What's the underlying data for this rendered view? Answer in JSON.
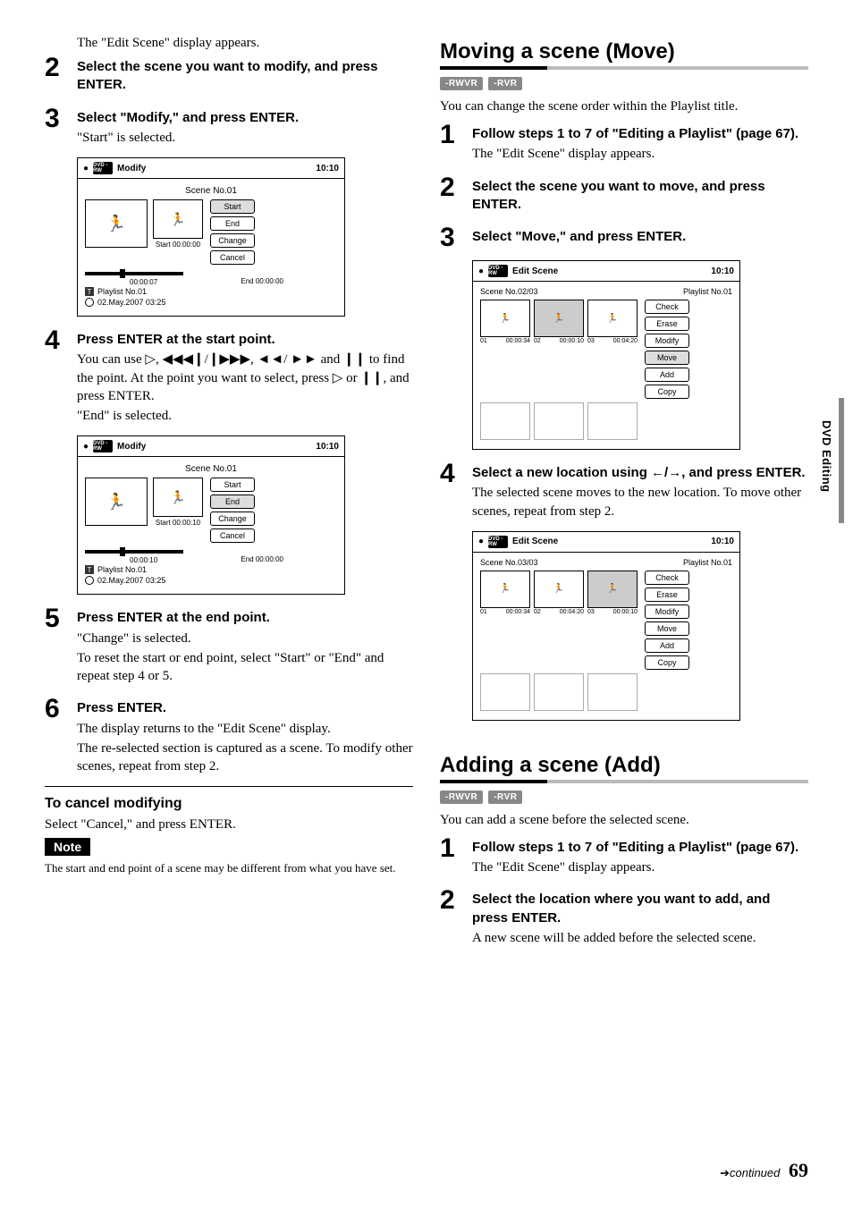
{
  "left": {
    "intro": "The \"Edit Scene\" display appears.",
    "step2": "Select the scene you want to modify, and press ENTER.",
    "step3_bold": "Select \"Modify,\" and press ENTER.",
    "step3_body": "\"Start\" is selected.",
    "ss1": {
      "title": "Modify",
      "clock": "10:10",
      "scene": "Scene No.01",
      "start": "Start  00:00:00",
      "end": "End   00:00:00",
      "barTime": "00:00:07",
      "pl": "Playlist No.01",
      "date": "02.May.2007   03:25",
      "btns": [
        "Start",
        "End",
        "Change",
        "Cancel"
      ],
      "sel": 0
    },
    "step4_bold": "Press ENTER at the start point.",
    "step4_l1a": "You can use ",
    "step4_l1b": ", ",
    "step4_l1c": "/",
    "step4_l1d": ", ",
    "step4_l1e": "/",
    "step4_l2a": " and ",
    "step4_l2b": " to find the point. At the point you want to select, press ",
    "step4_l2c": " or ",
    "step4_l2d": ", and press ENTER.",
    "step4_l3": "\"End\" is selected.",
    "ss2": {
      "title": "Modify",
      "clock": "10:10",
      "scene": "Scene No.01",
      "start": "Start  00:00:10",
      "end": "End   00:00:00",
      "barTime": "00:00:10",
      "pl": "Playlist No.01",
      "date": "02.May.2007   03:25",
      "btns": [
        "Start",
        "End",
        "Change",
        "Cancel"
      ],
      "sel": 1
    },
    "step5_bold": "Press ENTER at the end point.",
    "step5_l1": "\"Change\" is selected.",
    "step5_l2": "To reset the start or end point, select \"Start\" or \"End\" and repeat step 4 or 5.",
    "step6_bold": "Press ENTER.",
    "step6_l1": "The display returns to the \"Edit Scene\" display.",
    "step6_l2": "The re-selected section is captured as a scene. To modify other scenes, repeat from step 2.",
    "cancel_h": "To cancel modifying",
    "cancel_b": "Select \"Cancel,\" and press ENTER.",
    "note_label": "Note",
    "note_body": "The start and end point of a scene may be different from what you have set."
  },
  "right": {
    "moving_h": "Moving a scene (Move)",
    "badges": [
      "-RWVR",
      "-RVR"
    ],
    "moving_intro": "You can change the scene order within the Playlist title.",
    "m_step1_bold": "Follow steps 1 to 7 of \"Editing a Playlist\" (page 67).",
    "m_step1_body": "The \"Edit Scene\" display appears.",
    "m_step2_bold": "Select the scene you want to move, and press ENTER.",
    "m_step3_bold": "Select \"Move,\" and press ENTER.",
    "ssA": {
      "title": "Edit Scene",
      "clock": "10:10",
      "sceneNo": "Scene No.02/03",
      "pl": "Playlist No.01",
      "cells": [
        {
          "n": "01",
          "t": "00:00:34",
          "sel": false
        },
        {
          "n": "02",
          "t": "00:00:10",
          "sel": true
        },
        {
          "n": "03",
          "t": "00:04:20",
          "sel": false
        }
      ],
      "btns": [
        "Check",
        "Erase",
        "Modify",
        "Move",
        "Add",
        "Copy"
      ],
      "sel": 3
    },
    "m_step4_bold_a": "Select a new location using ",
    "m_step4_bold_b": "/",
    "m_step4_bold_c": ", and press ENTER.",
    "m_step4_l1": "The selected scene moves to the new location. To move other scenes, repeat from step 2.",
    "ssB": {
      "title": "Edit Scene",
      "clock": "10:10",
      "sceneNo": "Scene No.03/03",
      "pl": "Playlist No.01",
      "cells": [
        {
          "n": "01",
          "t": "00:00:34",
          "sel": false
        },
        {
          "n": "02",
          "t": "00:04:20",
          "sel": false
        },
        {
          "n": "03",
          "t": "00:00:10",
          "sel": true
        }
      ],
      "btns": [
        "Check",
        "Erase",
        "Modify",
        "Move",
        "Add",
        "Copy"
      ],
      "sel": -1
    },
    "adding_h": "Adding a scene (Add)",
    "adding_intro": "You can add a scene before the selected scene.",
    "a_step1_bold": "Follow steps 1 to 7 of \"Editing a Playlist\" (page 67).",
    "a_step1_body": "The \"Edit Scene\" display appears.",
    "a_step2_bold": "Select the location where you want to add, and press ENTER.",
    "a_step2_body": "A new scene will be added before the selected scene."
  },
  "sidebar": "DVD Editing",
  "footer_cont": "continued",
  "footer_page": "69",
  "dvd_label": "DVD -RW"
}
